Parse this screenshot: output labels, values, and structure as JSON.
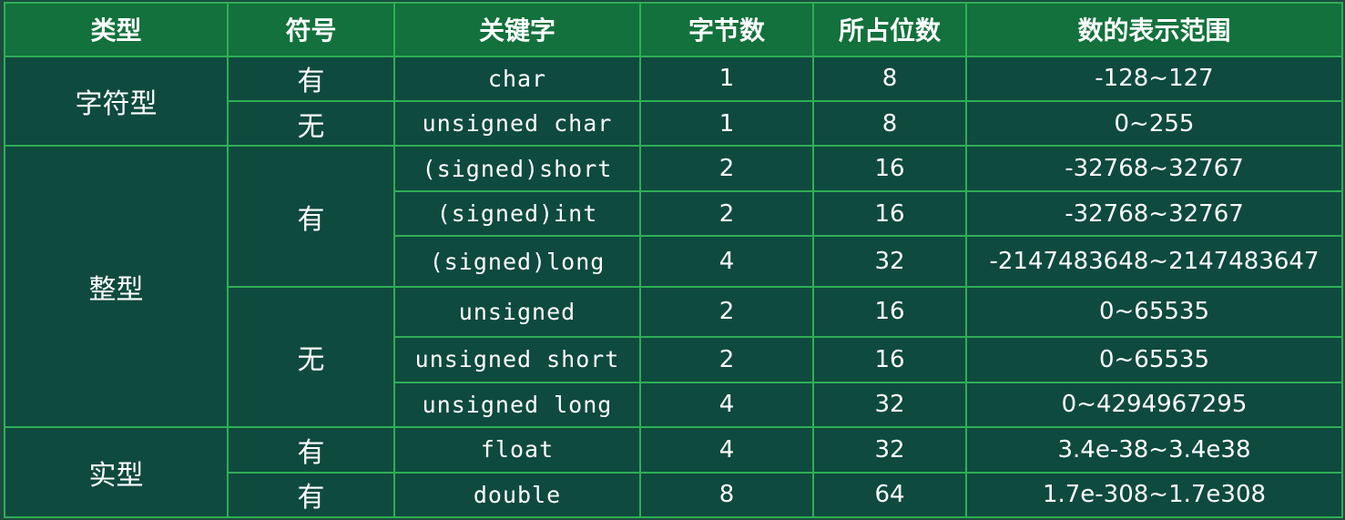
{
  "header": [
    "类型",
    "符号",
    "关键字",
    "字节数",
    "所占位数",
    "数的表示范围"
  ],
  "groups": {
    "char": "字符型",
    "int": "整型",
    "real": "实型"
  },
  "signs": {
    "char_signed": "有",
    "char_unsigned": "无",
    "int_signed": "有",
    "int_unsigned": "无",
    "float_signed": "有",
    "double_signed": "有"
  },
  "rows": [
    {
      "keyword": "char",
      "bytes": "1",
      "bits": "8",
      "range": "-128~127"
    },
    {
      "keyword": "unsigned char",
      "bytes": "1",
      "bits": "8",
      "range": "0~255"
    },
    {
      "keyword": "(signed)short",
      "bytes": "2",
      "bits": "16",
      "range": "-32768~32767"
    },
    {
      "keyword": "(signed)int",
      "bytes": "2",
      "bits": "16",
      "range": "-32768~32767"
    },
    {
      "keyword": "(signed)long",
      "bytes": "4",
      "bits": "32",
      "range": "-2147483648~2147483647"
    },
    {
      "keyword": "unsigned",
      "bytes": "2",
      "bits": "16",
      "range": "0~65535"
    },
    {
      "keyword": "unsigned short",
      "bytes": "2",
      "bits": "16",
      "range": "0~65535"
    },
    {
      "keyword": "unsigned long",
      "bytes": "4",
      "bits": "32",
      "range": "0~4294967295"
    },
    {
      "keyword": "float",
      "bytes": "4",
      "bits": "32",
      "range": "3.4e-38~3.4e38"
    },
    {
      "keyword": "double",
      "bytes": "8",
      "bits": "64",
      "range": "1.7e-308~1.7e308"
    }
  ],
  "colors": {
    "background": "#1e4b3f",
    "header_bg": "#12713c",
    "cell_bg": "#0f4a3e",
    "grid": "#2fae55",
    "text": "#ffffff"
  }
}
